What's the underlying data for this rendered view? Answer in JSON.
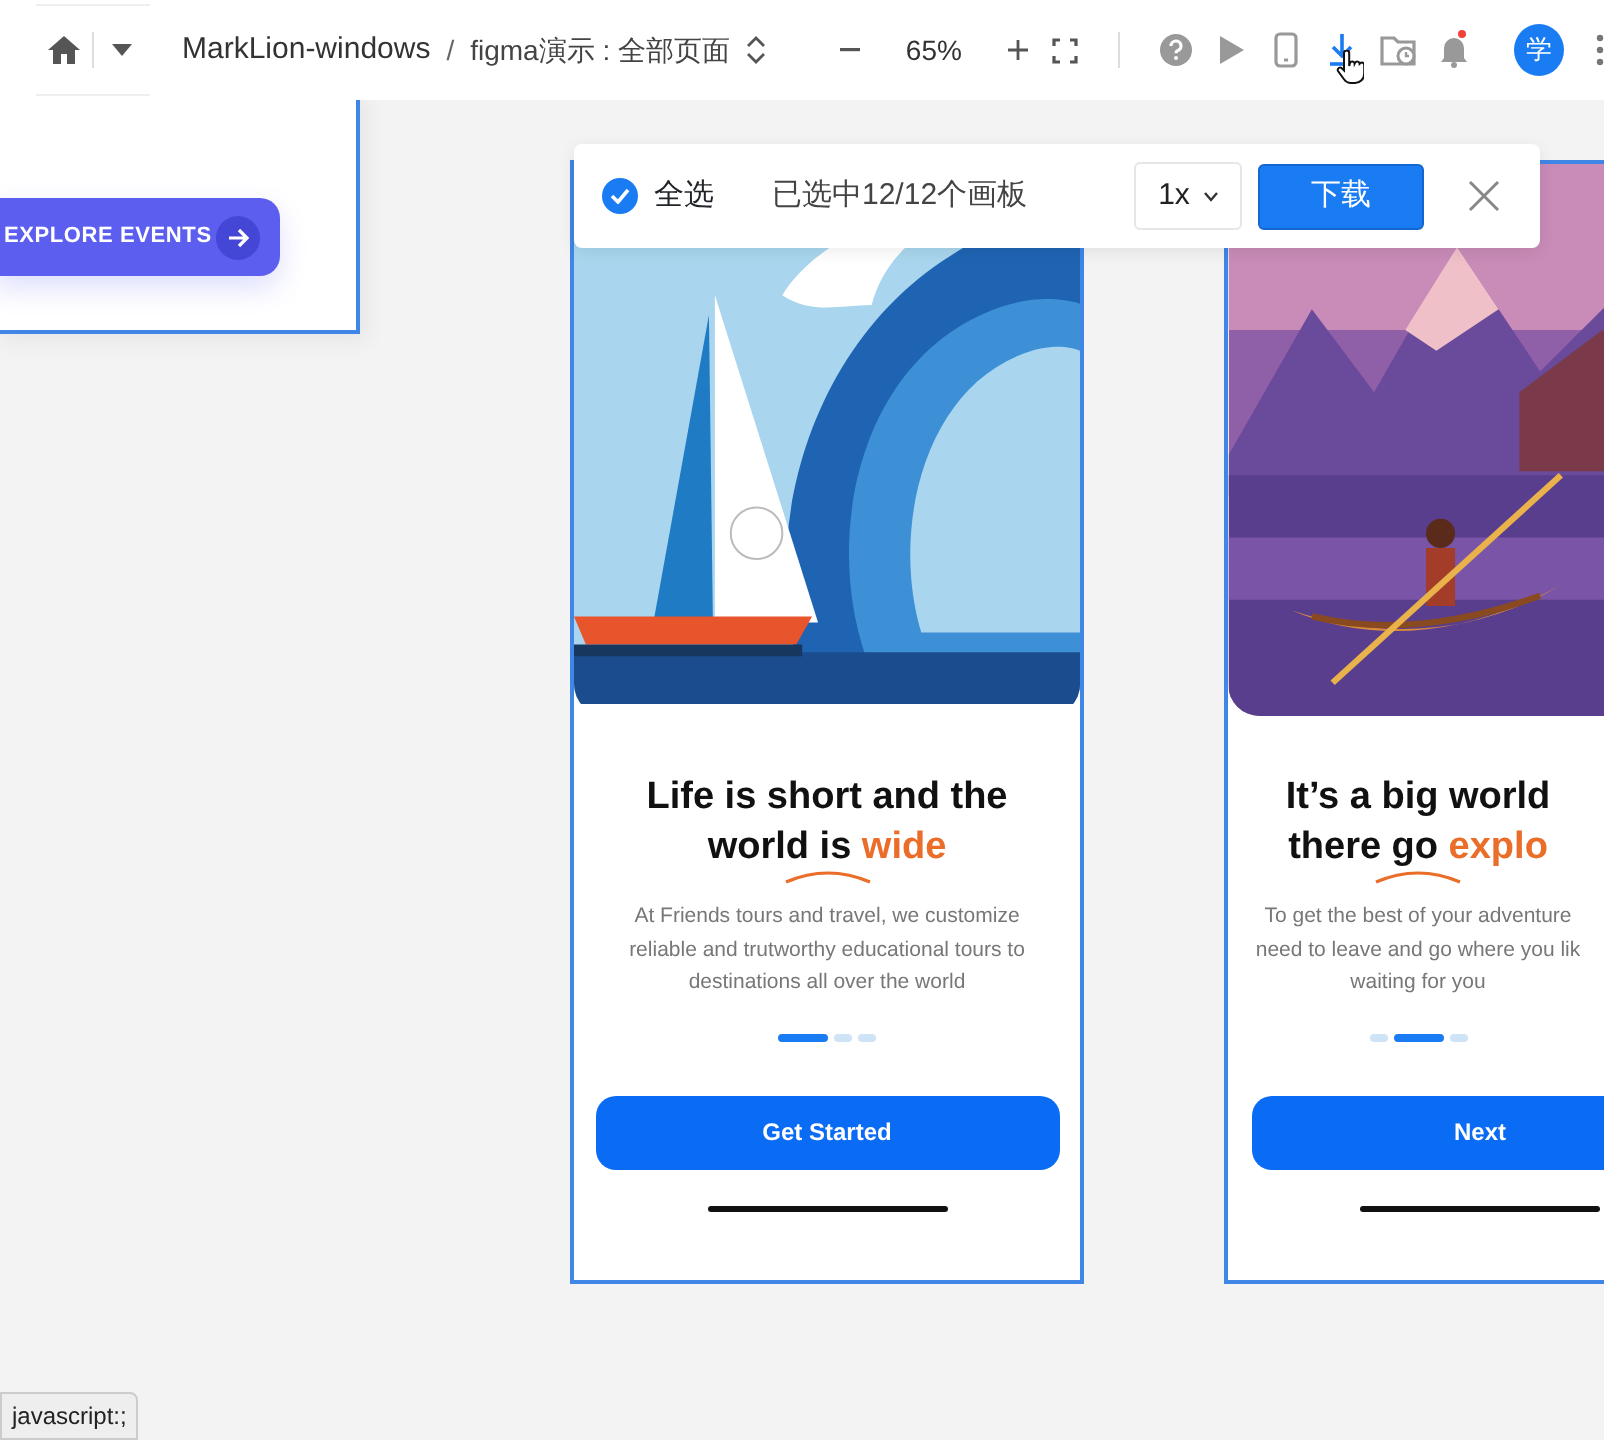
{
  "toolbar": {
    "project": "MarkLion-windows",
    "separator": "/",
    "page": "figma演示 : 全部页面",
    "zoom": "65%",
    "avatar": "学",
    "tools": [
      {
        "kind": "help",
        "selected": false
      },
      {
        "kind": "play",
        "selected": false
      },
      {
        "kind": "phone",
        "selected": false
      },
      {
        "kind": "download",
        "selected": true
      },
      {
        "kind": "folder",
        "selected": false
      },
      {
        "kind": "bell",
        "selected": false,
        "notification": true
      }
    ]
  },
  "download_panel": {
    "select_all": {
      "label": "全选",
      "checked": true
    },
    "status": "已选中12/12个画板",
    "scale": "1x",
    "download_button": "下载"
  },
  "artboards": [
    {
      "kind": "partial",
      "button": "EXPLORE EVENTS"
    },
    {
      "kind": "onboard",
      "title": [
        "Life is short and the",
        "world is **wide**"
      ],
      "body": [
        "At Friends tours and travel, we customize",
        "reliable and trutworthy educational tours to",
        "destinations all over the world"
      ],
      "dots": [
        {
          "selected": true
        },
        {
          "selected": false
        },
        {
          "selected": false
        }
      ],
      "button": "Get Started"
    },
    {
      "kind": "onboard",
      "title": [
        "It’s a big world",
        "there go **explo**"
      ],
      "body": [
        "To get the best of your adventure",
        "need to leave and go where you lik",
        "waiting for you"
      ],
      "dots": [
        {
          "selected": false
        },
        {
          "selected": true
        },
        {
          "selected": false
        }
      ],
      "button": "Next"
    }
  ],
  "status_tip": "javascript:;"
}
